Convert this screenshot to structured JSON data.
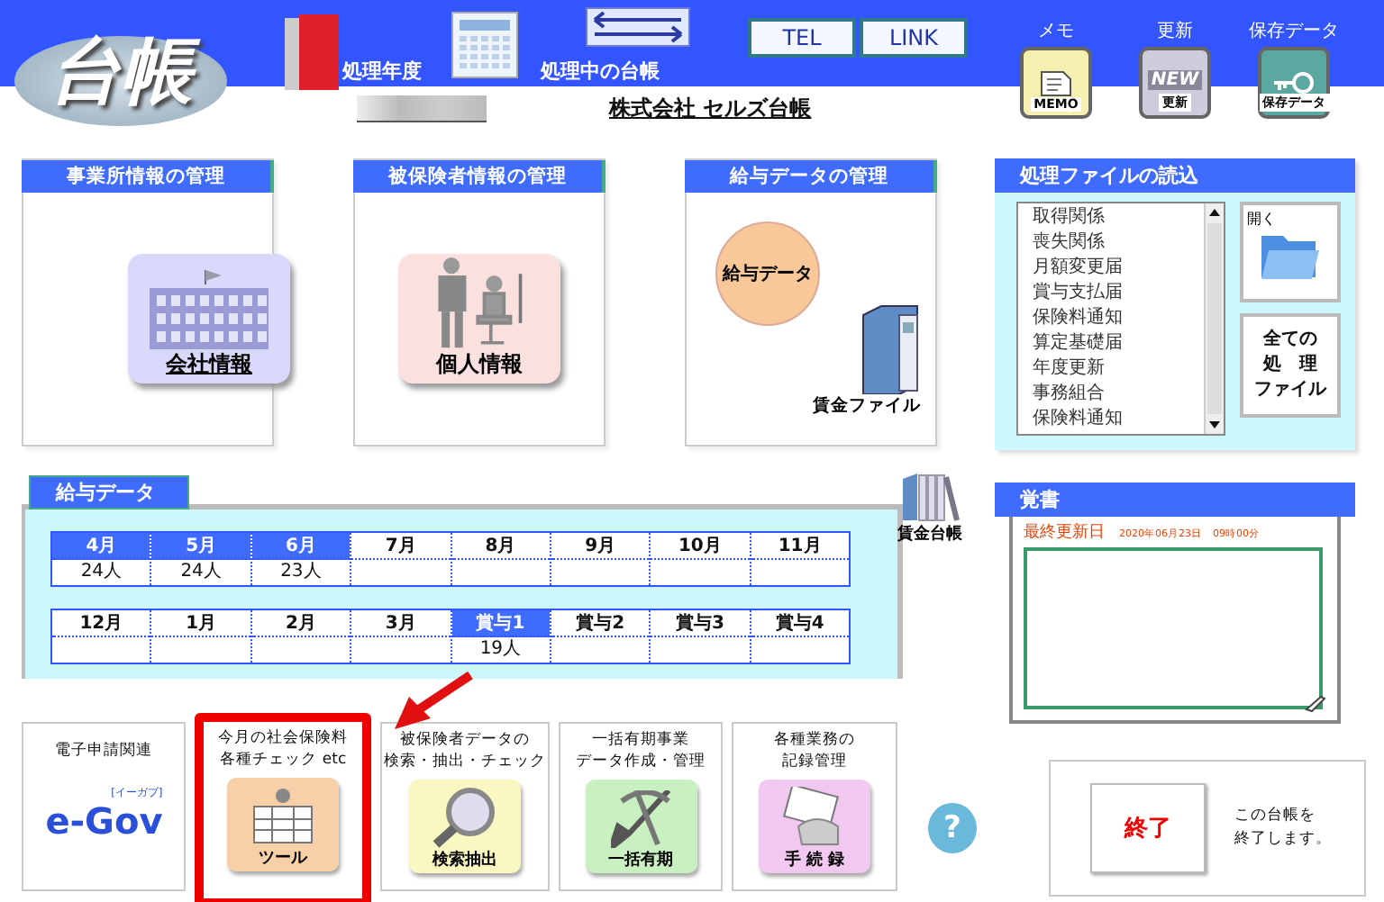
{
  "header": {
    "logo": "台帳",
    "year_label": "処理年度",
    "ledger_label": "処理中の台帳",
    "buttons": [
      "TEL",
      "LINK"
    ],
    "company": "株式会社 セルズ台帳",
    "tools": [
      {
        "label": "メモ",
        "icon_text": "MEMO",
        "kind": "memo"
      },
      {
        "label": "更新",
        "icon_text": "更新",
        "badge": "NEW",
        "kind": "update"
      },
      {
        "label": "保存データ",
        "icon_text": "保存データ",
        "kind": "save"
      }
    ]
  },
  "cards": [
    {
      "title": "事業所情報の管理",
      "icon_text": "会社情報",
      "kind": "company"
    },
    {
      "title": "被保険者情報の管理",
      "icon_text": "個人情報",
      "kind": "person"
    },
    {
      "title": "給与データの管理",
      "icon_text": "給与データ",
      "file_label": "賃金ファイル",
      "kind": "salary"
    }
  ],
  "file_panel": {
    "title": "処理ファイルの読込",
    "items": [
      "取得関係",
      "喪失関係",
      "月額変更届",
      "賞与支払届",
      "保険料通知",
      "算定基礎届",
      "年度更新",
      "事務組合",
      "保険料通知"
    ],
    "open_label": "開く",
    "all_button": [
      "全ての",
      "処　理",
      "ファイル"
    ]
  },
  "salary_data": {
    "title": "給与データ",
    "ledger_label": "賃金台帳",
    "rows": [
      [
        {
          "month": "4月",
          "highlighted": true,
          "count": "24人"
        },
        {
          "month": "5月",
          "highlighted": true,
          "count": "24人"
        },
        {
          "month": "6月",
          "highlighted": true,
          "count": "23人"
        },
        {
          "month": "7月",
          "highlighted": false
        },
        {
          "month": "8月",
          "highlighted": false
        },
        {
          "month": "9月",
          "highlighted": false
        },
        {
          "month": "10月",
          "highlighted": false
        },
        {
          "month": "11月",
          "highlighted": false
        }
      ],
      [
        {
          "month": "12月",
          "highlighted": false
        },
        {
          "month": "1月",
          "highlighted": false
        },
        {
          "month": "2月",
          "highlighted": false
        },
        {
          "month": "3月",
          "highlighted": false
        },
        {
          "month": "賞与1",
          "highlighted": true,
          "count": "19人"
        },
        {
          "month": "賞与2",
          "highlighted": false
        },
        {
          "month": "賞与3",
          "highlighted": false
        },
        {
          "month": "賞与4",
          "highlighted": false
        }
      ]
    ]
  },
  "memo": {
    "title": "覚書",
    "updated_label": "最終更新日",
    "updated_value": "2020年06月23日　09時00分"
  },
  "bottom_tools": [
    {
      "caption": [
        "電子申請関連"
      ],
      "icon_text": "e-Gov",
      "badge": "[イーガブ]",
      "kind": "egov",
      "highlighted": false
    },
    {
      "caption": [
        "今月の社会保険料",
        "各種チェック etc"
      ],
      "icon_text": "ツール",
      "kind": "tool",
      "highlighted": true
    },
    {
      "caption": [
        "被保険者データの",
        "検索・抽出・チェック"
      ],
      "icon_text": "検索抽出",
      "kind": "search",
      "highlighted": false
    },
    {
      "caption": [
        "一括有期事業",
        "データ作成・管理"
      ],
      "icon_text": "一括有期",
      "kind": "shovel",
      "highlighted": false
    },
    {
      "caption": [
        "各種業務の",
        "記録管理"
      ],
      "icon_text": "手 続 録",
      "kind": "record",
      "highlighted": false
    }
  ],
  "help": "?",
  "exit": {
    "button": "終了",
    "note": [
      "この台帳を",
      "終了します。"
    ]
  }
}
